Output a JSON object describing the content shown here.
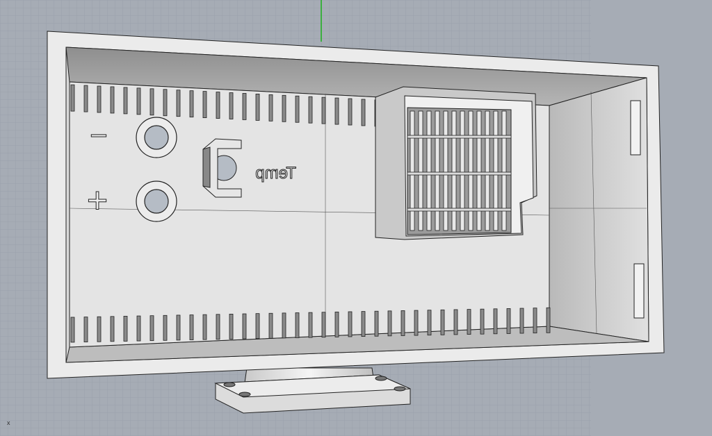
{
  "viewport": {
    "background_color": "#a6acb5",
    "grid_color": "#9aa1ab",
    "axis_label": "x",
    "axis_color": "#19b019"
  },
  "model": {
    "embossed_text": "Temp",
    "minus_symbol": "−",
    "plus_symbol": "+",
    "body_color": "#e6e6e6"
  }
}
